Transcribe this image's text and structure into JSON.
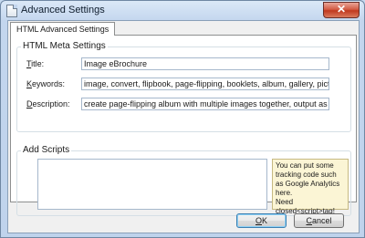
{
  "window": {
    "title": "Advanced Settings",
    "close_glyph": "✕",
    "icon": "document-icon"
  },
  "tabs": [
    {
      "label": "HTML Advanced Settings",
      "active": true
    }
  ],
  "meta": {
    "legend": "HTML Meta Settings",
    "title_label_accel": "T",
    "title_label_rest": "itle:",
    "title_value": "Image eBrochure",
    "keywords_label_accel": "K",
    "keywords_label_rest": "eywords:",
    "keywords_value": "image, convert, flipbook, page-flipping, booklets, album, gallery, picture, photo",
    "description_label_accel": "D",
    "description_label_rest": "escription:",
    "description_value": "create page-flipping album with multiple images together, output as HTML page"
  },
  "scripts": {
    "legend": "Add Scripts",
    "value": "",
    "hint_line1": "You can put some tracking code such as Google Analytics here.",
    "hint_line2": "Need closed<script>tag!"
  },
  "buttons": {
    "ok_accel": "O",
    "ok_rest": "K",
    "cancel_accel": "C",
    "cancel_rest": "ancel"
  },
  "colors": {
    "hint_background": "#fbf5d5",
    "close_button": "#c0391f"
  }
}
